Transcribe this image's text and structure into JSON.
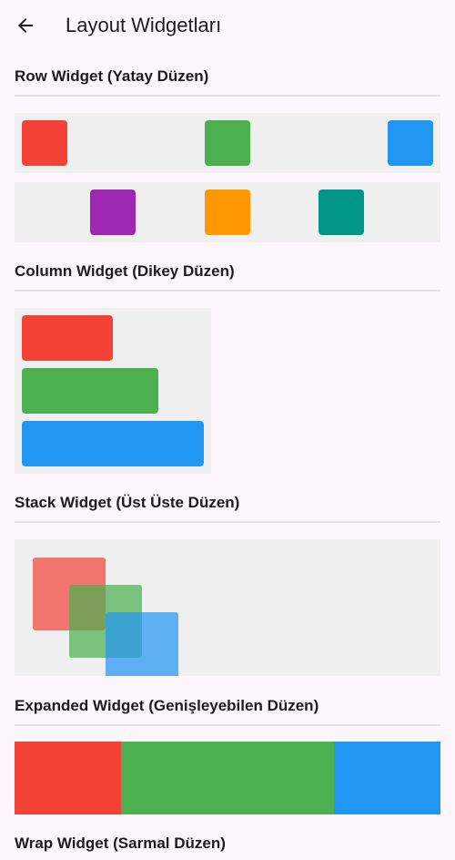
{
  "appbar": {
    "title": "Layout Widgetları",
    "back_icon": "arrow-back-icon"
  },
  "sections": {
    "row": {
      "title": "Row Widget (Yatay Düzen)"
    },
    "column": {
      "title": "Column Widget (Dikey Düzen)"
    },
    "stack": {
      "title": "Stack Widget (Üst Üste Düzen)"
    },
    "expanded": {
      "title": "Expanded Widget (Genişleyebilen Düzen)"
    },
    "wrap": {
      "title": "Wrap Widget (Sarmal Düzen)"
    }
  },
  "colors": {
    "red": "#f44336",
    "green": "#4caf50",
    "blue": "#2196f3",
    "purple": "#9c27b0",
    "orange": "#ff9800",
    "teal": "#009688",
    "panel": "#efefef",
    "background": "#fdf7fd"
  }
}
